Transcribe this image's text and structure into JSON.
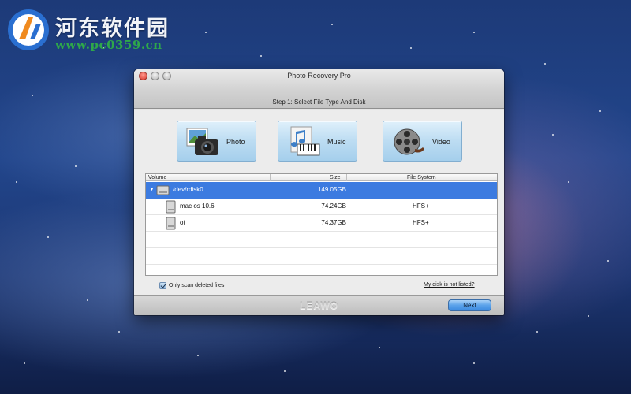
{
  "watermark": {
    "title": "河东软件园",
    "url": "www.pc0359.cn"
  },
  "window": {
    "title": "Photo Recovery Pro",
    "step_title": "Step 1: Select File Type And Disk"
  },
  "file_types": [
    {
      "label": "Photo",
      "icon": "camera-icon"
    },
    {
      "label": "Music",
      "icon": "music-icon"
    },
    {
      "label": "Video",
      "icon": "film-reel-icon"
    }
  ],
  "table": {
    "columns": [
      "Volume",
      "Size",
      "File System"
    ],
    "rows": [
      {
        "volume": "/dev/rdisk0",
        "size": "149.05GB",
        "file_system": "",
        "selected": true,
        "expanded": true
      },
      {
        "volume": "mac os 10.6",
        "size": "74.24GB",
        "file_system": "HFS+",
        "selected": false
      },
      {
        "volume": "ot",
        "size": "74.37GB",
        "file_system": "HFS+",
        "selected": false
      }
    ]
  },
  "options": {
    "only_deleted_label": "Only scan deleted files",
    "only_deleted_checked": true,
    "disk_not_listed_link": "My disk is not listed?"
  },
  "footer": {
    "brand": "LEAWO",
    "next_label": "Next"
  },
  "colors": {
    "selection": "#3c7be0",
    "button_blue": "#5aa2ea",
    "url_green": "#2ea84a"
  }
}
